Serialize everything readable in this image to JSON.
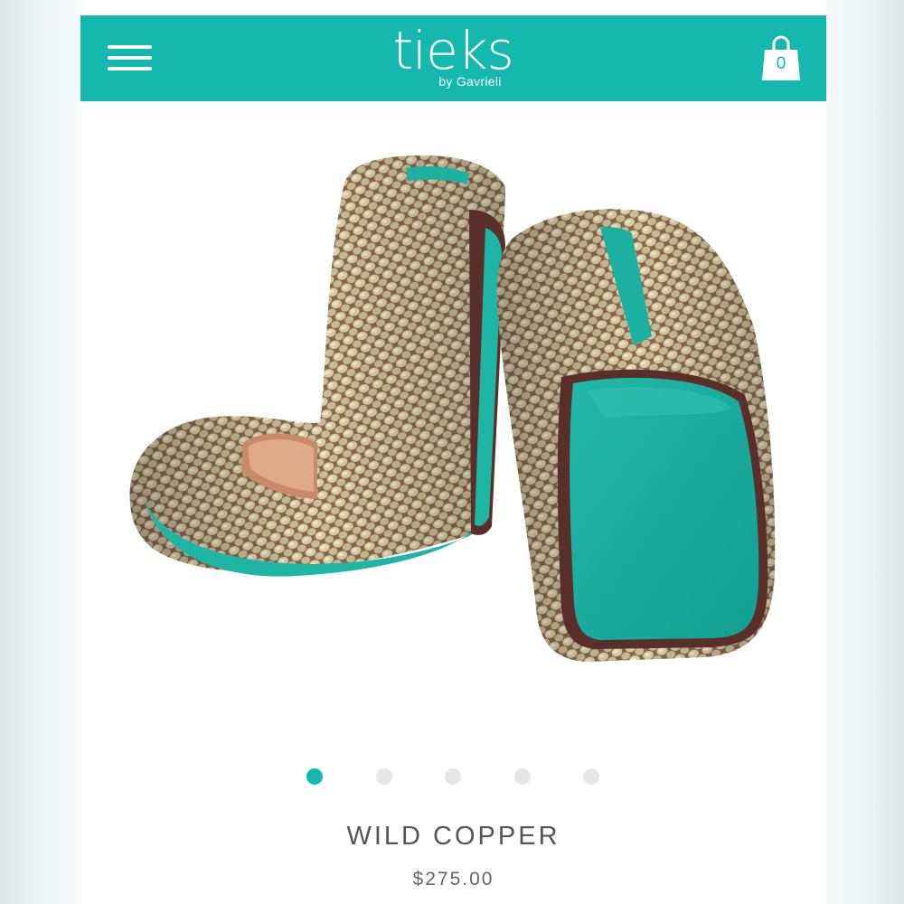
{
  "header": {
    "brand": "tieks",
    "brand_subtitle": "by Gavrieli",
    "cart_count": "0",
    "menu_icon": "hamburger-menu-icon",
    "cart_icon": "shopping-bag-icon",
    "background_color": "#14b8ad"
  },
  "gallery": {
    "image_description_icon": "product-photo",
    "slide_count": 5,
    "active_index": 0,
    "active_color": "#14b8ad",
    "inactive_color": "#e6e6e6"
  },
  "product": {
    "name": "WILD COPPER",
    "price": "$275.00"
  }
}
